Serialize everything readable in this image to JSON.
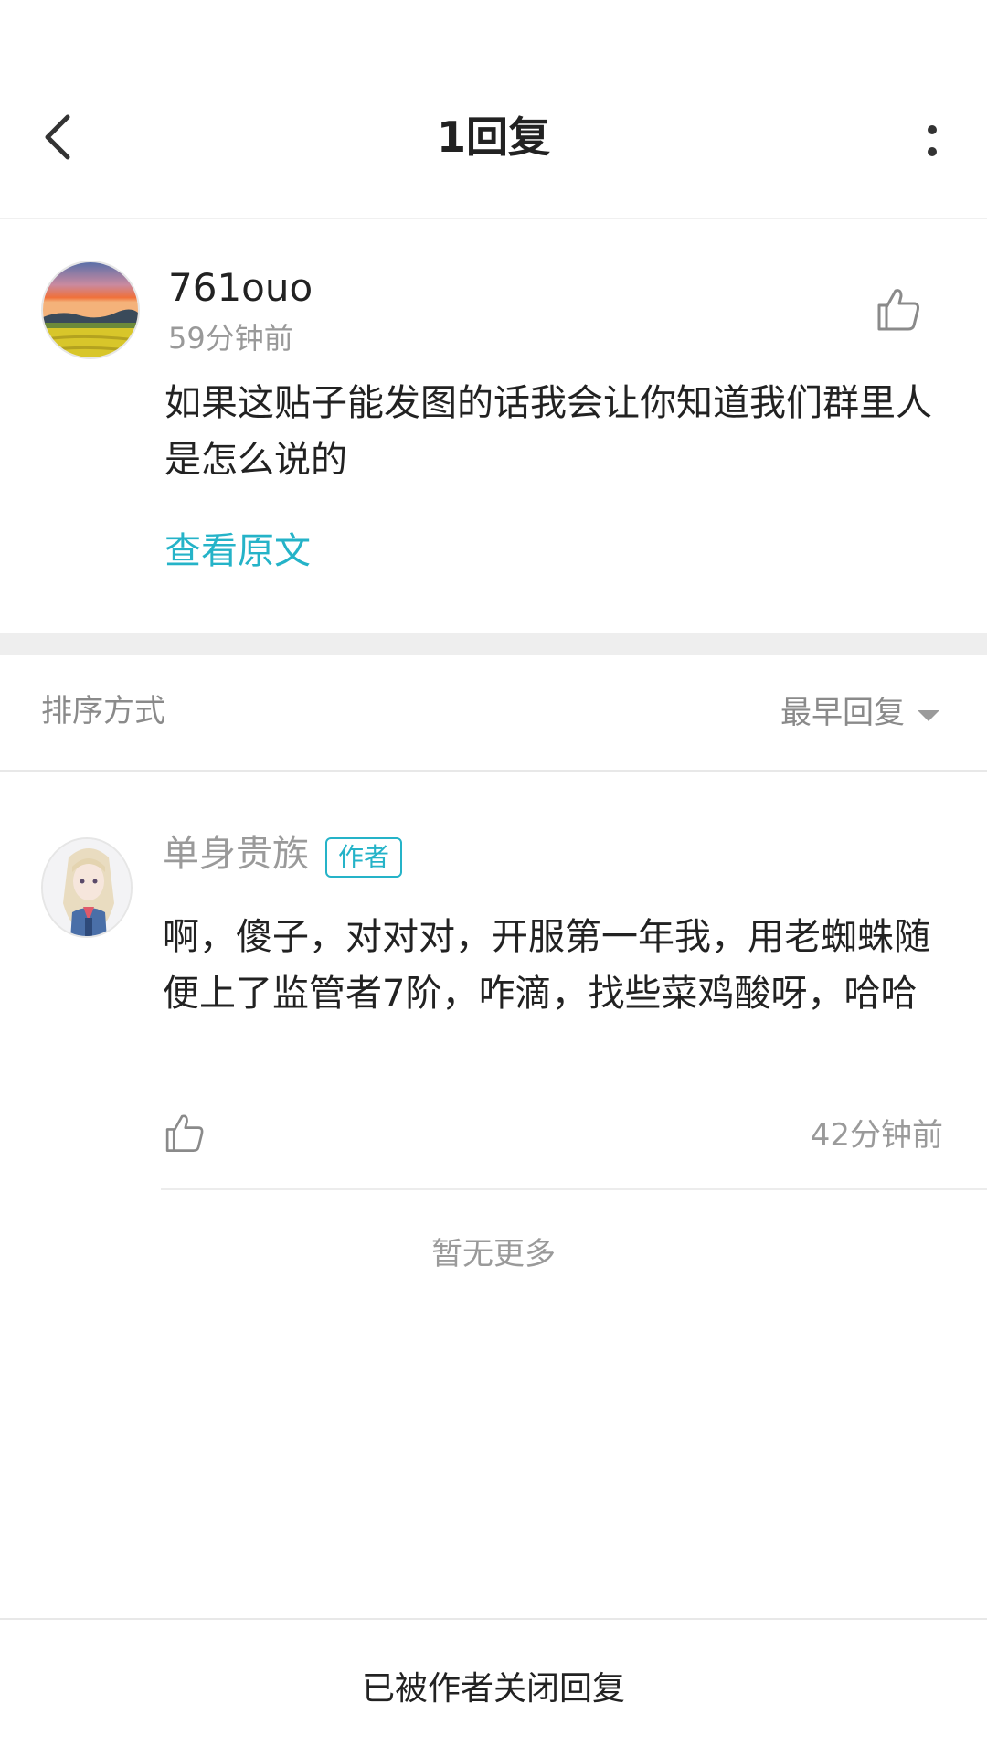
{
  "header": {
    "title": "1回复",
    "back_icon": "back-arrow-icon",
    "more_icon": "more-vertical-icon"
  },
  "post": {
    "username": "761ouo",
    "time": "59分钟前",
    "content": "如果这贴子能发图的话我会让你知道我们群里人是怎么说的",
    "view_original": "查看原文",
    "like_icon": "thumbs-up-icon"
  },
  "sort": {
    "label": "排序方式",
    "value": "最早回复",
    "caret_icon": "caret-down-icon"
  },
  "replies": [
    {
      "username": "单身贵族",
      "badge": "作者",
      "content": "啊，傻子，对对对，开服第一年我，用老蜘蛛随便上了监管者7阶，咋滴，找些菜鸡酸呀，哈哈",
      "time": "42分钟前",
      "like_icon": "thumbs-up-icon"
    }
  ],
  "no_more": "暂无更多",
  "bottom": {
    "closed_text": "已被作者关闭回复"
  },
  "colors": {
    "accent": "#25b3c8",
    "text_primary": "#222222",
    "text_secondary": "#999999",
    "separator": "#eeeeee"
  }
}
